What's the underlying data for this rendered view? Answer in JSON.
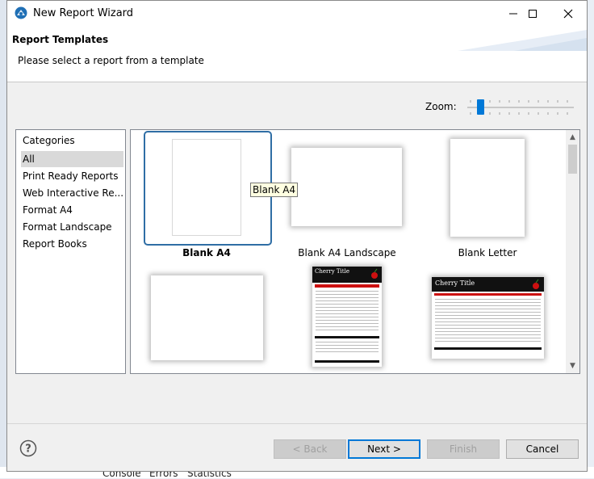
{
  "window": {
    "title": "New Report Wizard",
    "minimize_glyph": "—",
    "maximize_glyph": "☐",
    "close_glyph": "✕"
  },
  "header": {
    "title": "Report Templates",
    "description": "Please select a report from a template"
  },
  "zoom": {
    "label": "Zoom:",
    "level": 0.1
  },
  "categories": {
    "header": "Categories",
    "items": [
      {
        "label": "All",
        "selected": true
      },
      {
        "label": "Print Ready Reports",
        "selected": false
      },
      {
        "label": "Web Interactive Re...",
        "selected": false
      },
      {
        "label": "Format A4",
        "selected": false
      },
      {
        "label": "Format Landscape",
        "selected": false
      },
      {
        "label": "Report Books",
        "selected": false
      }
    ]
  },
  "templates": {
    "items": [
      {
        "label": "Blank A4",
        "selected": true
      },
      {
        "label": "Blank A4 Landscape",
        "selected": false
      },
      {
        "label": "Blank Letter",
        "selected": false
      },
      {
        "label": "",
        "selected": false
      },
      {
        "label": "",
        "selected": false,
        "thumb_title": "Cherry Title"
      },
      {
        "label": "",
        "selected": false,
        "thumb_title": "Cherry Title"
      }
    ],
    "tooltip": "Blank A4"
  },
  "buttons": {
    "back": "< Back",
    "next": "Next >",
    "finish": "Finish",
    "cancel": "Cancel"
  },
  "background": {
    "tabs": [
      "Console",
      "Errors",
      "Statistics"
    ]
  },
  "colors": {
    "accent": "#0078d7",
    "selection_border": "#2f6ea5",
    "cherry_red": "#cc1010"
  },
  "icons": {
    "app": "wizard-app-icon",
    "help": "help-icon"
  }
}
